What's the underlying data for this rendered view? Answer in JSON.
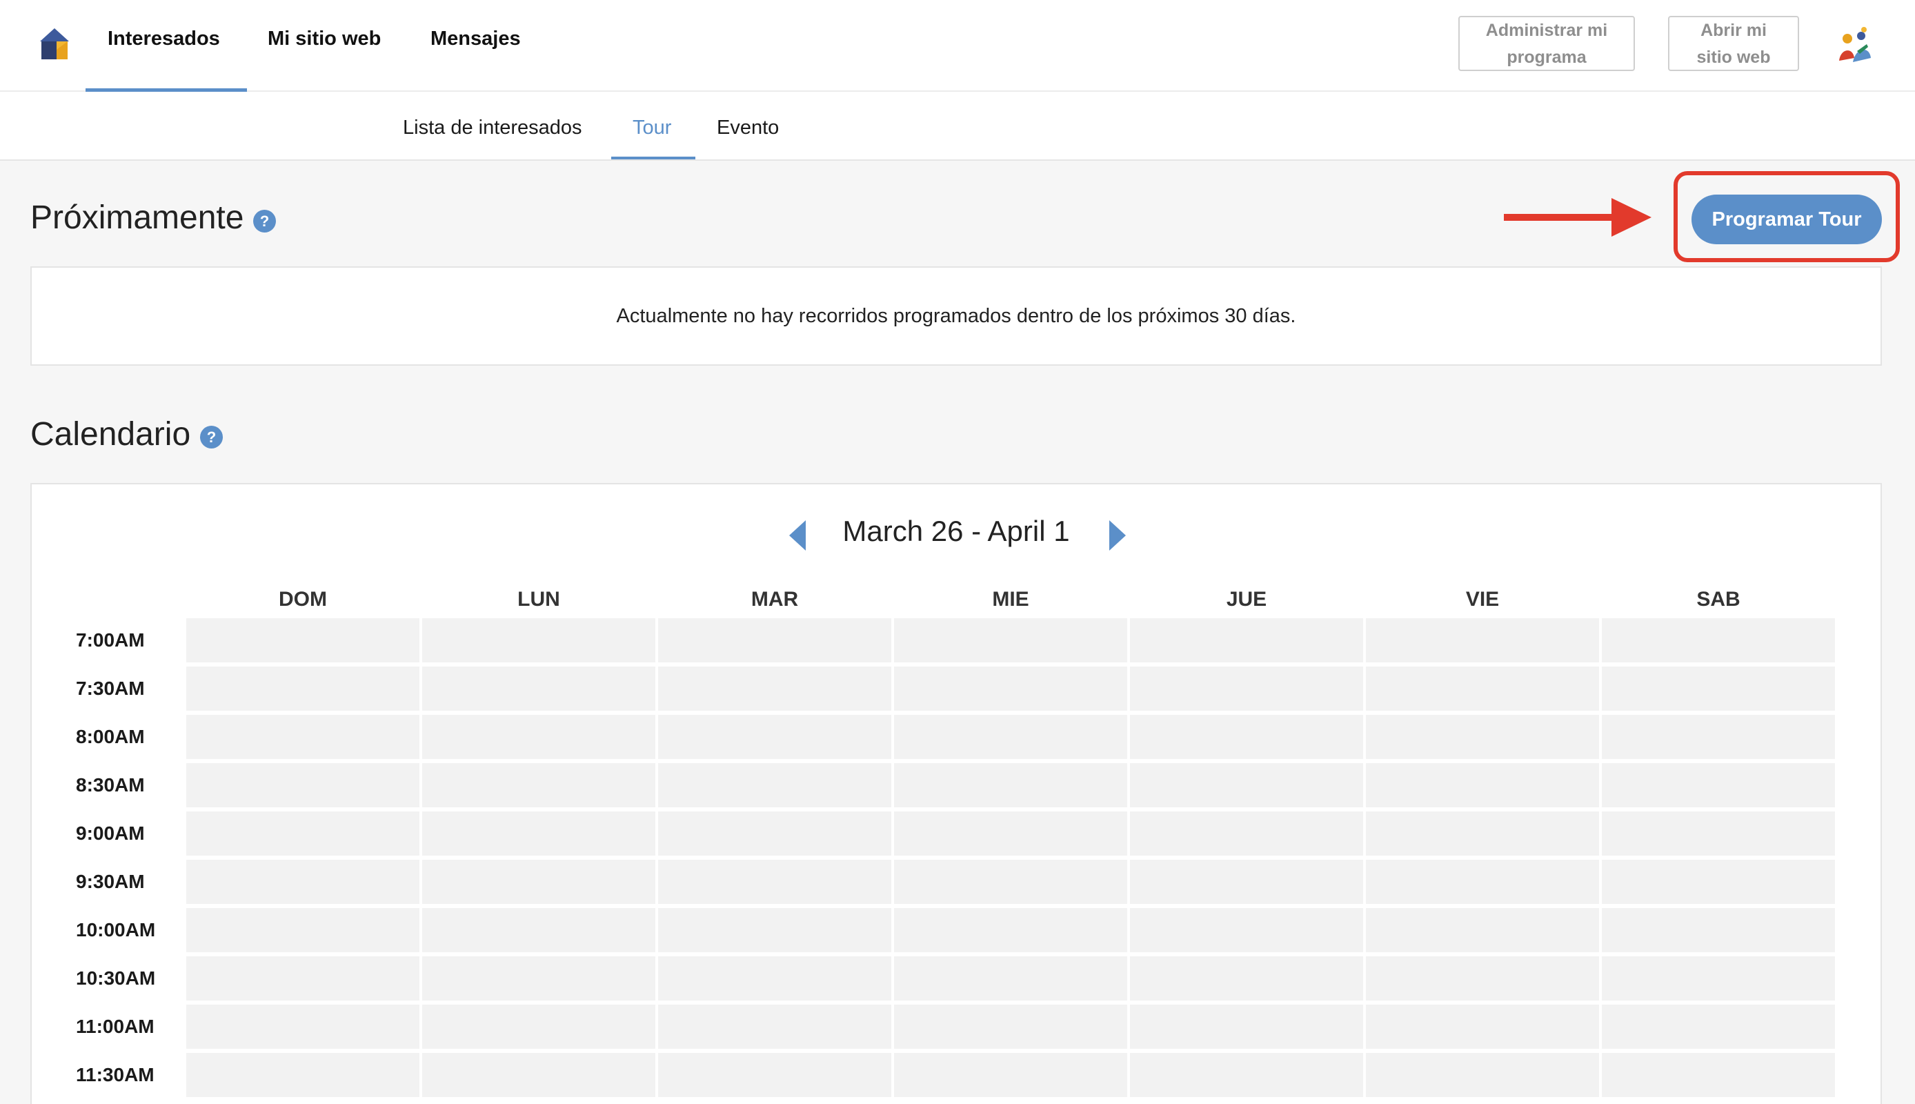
{
  "topnav": {
    "items": [
      "Interesados",
      "Mi sitio web",
      "Mensajes"
    ],
    "manage_button": "Administrar mi programa",
    "manage_button_lines": [
      "Administrar mi",
      "programa"
    ],
    "open_site_button": "Abrir mi sitio web",
    "open_site_button_lines": [
      "Abrir mi",
      "sitio web"
    ]
  },
  "subnav": {
    "tabs": [
      "Lista de interesados",
      "Tour",
      "Evento"
    ],
    "active_tab": "Tour"
  },
  "upcoming": {
    "title": "Próximamente",
    "help_icon": "?",
    "schedule_button": "Programar Tour",
    "empty_message": "Actualmente no hay recorridos programados dentro de los próximos 30 días."
  },
  "calendar": {
    "title": "Calendario",
    "help_icon": "?",
    "week_range": "March 26 - April 1",
    "days": [
      "DOM",
      "LUN",
      "MAR",
      "MIE",
      "JUE",
      "VIE",
      "SAB"
    ],
    "times": [
      "7:00AM",
      "7:30AM",
      "8:00AM",
      "8:30AM",
      "9:00AM",
      "9:30AM",
      "10:00AM",
      "10:30AM",
      "11:00AM",
      "11:30AM"
    ]
  },
  "colors": {
    "accent": "#5b8fc9",
    "highlight": "#e23a2c",
    "slot": "#f2f2f2",
    "background": "#f6f6f6"
  },
  "icons": {
    "logo": "house-logo-icon",
    "help": "question-circle-icon",
    "prev": "triangle-left-icon",
    "next": "triangle-right-icon",
    "arrow": "red-arrow-right-icon",
    "avatar": "user-avatar-icon"
  }
}
